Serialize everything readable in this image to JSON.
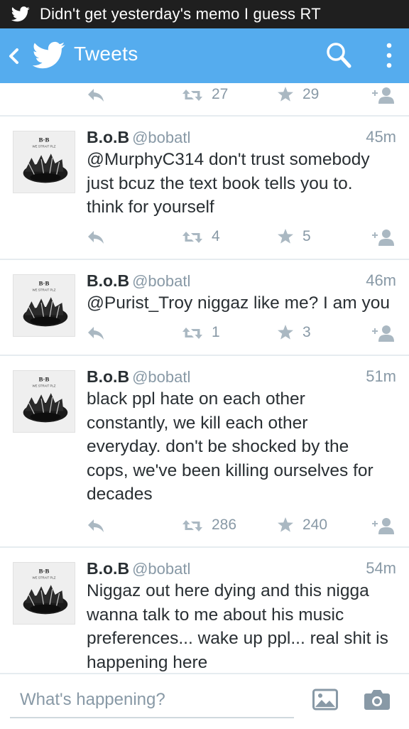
{
  "notification": {
    "text": "Didn't get yesterday's memo I guess RT"
  },
  "actionbar": {
    "title": "Tweets"
  },
  "top_partial": {
    "retweets": "27",
    "favorites": "29"
  },
  "tweets": [
    {
      "name": "B.o.B",
      "handle": "@bobatl",
      "time": "45m",
      "text": "@MurphyC314 don't trust somebody\njust bcuz the text book tells you to.\nthink for yourself",
      "retweets": "4",
      "favorites": "5",
      "avatar_text": "B.o.B"
    },
    {
      "name": "B.o.B",
      "handle": "@bobatl",
      "time": "46m",
      "text": "@Purist_Troy niggaz like me? I am you",
      "retweets": "1",
      "favorites": "3",
      "avatar_text": "B.o.B"
    },
    {
      "name": "B.o.B",
      "handle": "@bobatl",
      "time": "51m",
      "text": "black ppl hate on each other\nconstantly, we kill each other\neveryday. don't be shocked by the\ncops, we've been killing ourselves for\ndecades",
      "retweets": "286",
      "favorites": "240",
      "avatar_text": "B.o.B"
    },
    {
      "name": "B.o.B",
      "handle": "@bobatl",
      "time": "54m",
      "text": "Niggaz out here dying and this nigga\nwanna talk to me about his music\npreferences... wake up ppl... real shit is\nhappening here",
      "avatar_text": "B.o.B"
    }
  ],
  "compose": {
    "placeholder": "What's happening?"
  },
  "colors": {
    "brand_blue": "#55acee",
    "status_bar": "#1f1f1f",
    "meta_grey": "#8899a6"
  },
  "icons": [
    "twitter-bird-icon",
    "back-icon",
    "search-icon",
    "overflow-menu-icon",
    "reply-icon",
    "retweet-icon",
    "star-icon",
    "follow-icon",
    "photo-icon",
    "camera-icon"
  ]
}
